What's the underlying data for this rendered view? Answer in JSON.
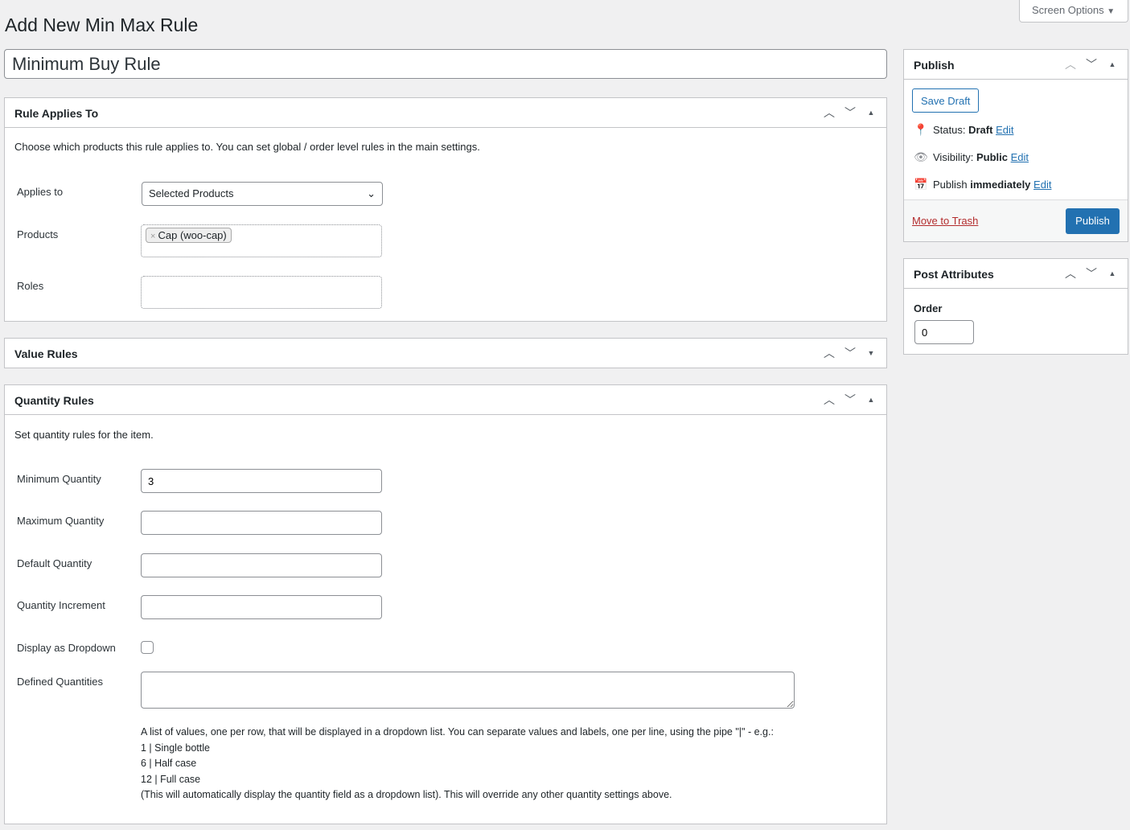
{
  "header": {
    "screen_options": "Screen Options",
    "page_title": "Add New Min Max Rule",
    "title_value": "Minimum Buy Rule"
  },
  "rule_applies": {
    "title": "Rule Applies To",
    "description": "Choose which products this rule applies to. You can set global / order level rules in the main settings.",
    "applies_label": "Applies to",
    "applies_value": "Selected Products",
    "products_label": "Products",
    "product_tag": "Cap (woo-cap)",
    "roles_label": "Roles"
  },
  "value_rules": {
    "title": "Value Rules"
  },
  "quantity_rules": {
    "title": "Quantity Rules",
    "description": "Set quantity rules for the item.",
    "min_label": "Minimum Quantity",
    "min_value": "3",
    "max_label": "Maximum Quantity",
    "default_label": "Default Quantity",
    "increment_label": "Quantity Increment",
    "dropdown_label": "Display as Dropdown",
    "dropdown_checked": false,
    "defined_label": "Defined Quantities",
    "help": [
      "A list of values, one per row, that will be displayed in a dropdown list. You can separate values and labels, one per line, using the pipe \"|\" - e.g.:",
      "1 | Single bottle",
      "6 | Half case",
      "12 | Full case",
      "(This will automatically display the quantity field as a dropdown list). This will override any other quantity settings above."
    ]
  },
  "publish": {
    "title": "Publish",
    "save_draft": "Save Draft",
    "status_label": "Status:",
    "status_value": "Draft",
    "visibility_label": "Visibility:",
    "visibility_value": "Public",
    "publish_label": "Publish",
    "publish_value": "immediately",
    "edit": "Edit",
    "trash": "Move to Trash",
    "publish_button": "Publish",
    "accent": "#2271b1"
  },
  "post_attributes": {
    "title": "Post Attributes",
    "order_label": "Order",
    "order_value": "0"
  }
}
